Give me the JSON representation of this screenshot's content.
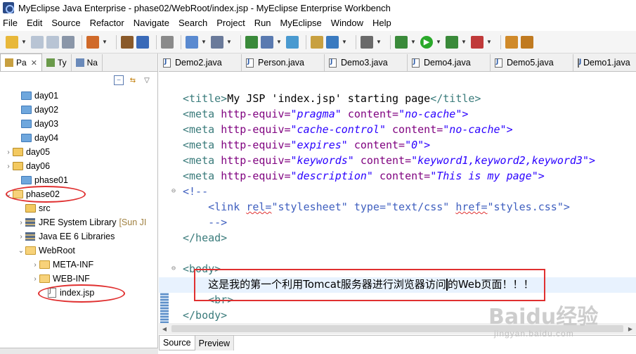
{
  "window": {
    "title": "MyEclipse Java Enterprise - phase02/WebRoot/index.jsp - MyEclipse Enterprise Workbench"
  },
  "menu": [
    "File",
    "Edit",
    "Source",
    "Refactor",
    "Navigate",
    "Search",
    "Project",
    "Run",
    "MyEclipse",
    "Window",
    "Help"
  ],
  "left_tabs": [
    {
      "label": "Pa",
      "icon": "package-explorer-icon",
      "active": true
    },
    {
      "label": "Ty",
      "icon": "type-hierarchy-icon",
      "active": false
    },
    {
      "label": "Na",
      "icon": "navigator-icon",
      "active": false
    }
  ],
  "tree": {
    "day01": "day01",
    "day02": "day02",
    "day03": "day03",
    "day04": "day04",
    "day05": "day05",
    "day06": "day06",
    "phase01": "phase01",
    "phase02": "phase02",
    "src": "src",
    "jre": "JRE System Library",
    "jre_suffix": "[Sun JI",
    "javaee": "Java EE 6 Libraries",
    "webroot": "WebRoot",
    "metainf": "META-INF",
    "webinf": "WEB-INF",
    "indexjsp": "index.jsp"
  },
  "editor_tabs": [
    "Demo2.java",
    "Person.java",
    "Demo3.java",
    "Demo4.java",
    "Demo5.java",
    "Demo1.java"
  ],
  "code": {
    "title_open": "<title>",
    "title_text": "My JSP 'index.jsp' starting page",
    "title_close": "</title>",
    "meta": "<meta",
    "http_equiv": "http-equiv=",
    "content_attr": "content=",
    "pragma": "\"pragma\"",
    "no_cache": "\"no-cache\">",
    "cache_control": "\"cache-control\"",
    "no_cache2": "\"no-cache\">",
    "expires": "\"expires\"",
    "zero": "\"0\">",
    "keywords": "\"keywords\"",
    "keywords_val": "\"keyword1,keyword2,keyword3\">",
    "description": "\"description\"",
    "desc_val": "\"This is my page\">",
    "comment_open": "<!--",
    "link_open": "<link",
    "rel": "rel=",
    "rel_val": "\"stylesheet\"",
    "type": "type=",
    "type_val": "\"text/css\"",
    "href": "href=",
    "href_val": "\"styles.css\">",
    "comment_close": "-->",
    "head_close": "</head>",
    "body_open": "<body>",
    "body_text_a": "这是我的第一个利用Tomcat服务器进行浏览器访问",
    "body_text_b": "的Web页面！！！",
    "br": "<br>",
    "body_close": "</body>"
  },
  "bottom_tabs": [
    "Source",
    "Preview"
  ],
  "watermark": {
    "logo": "Baidu经验",
    "sub": "jingyan.baidu.com"
  }
}
